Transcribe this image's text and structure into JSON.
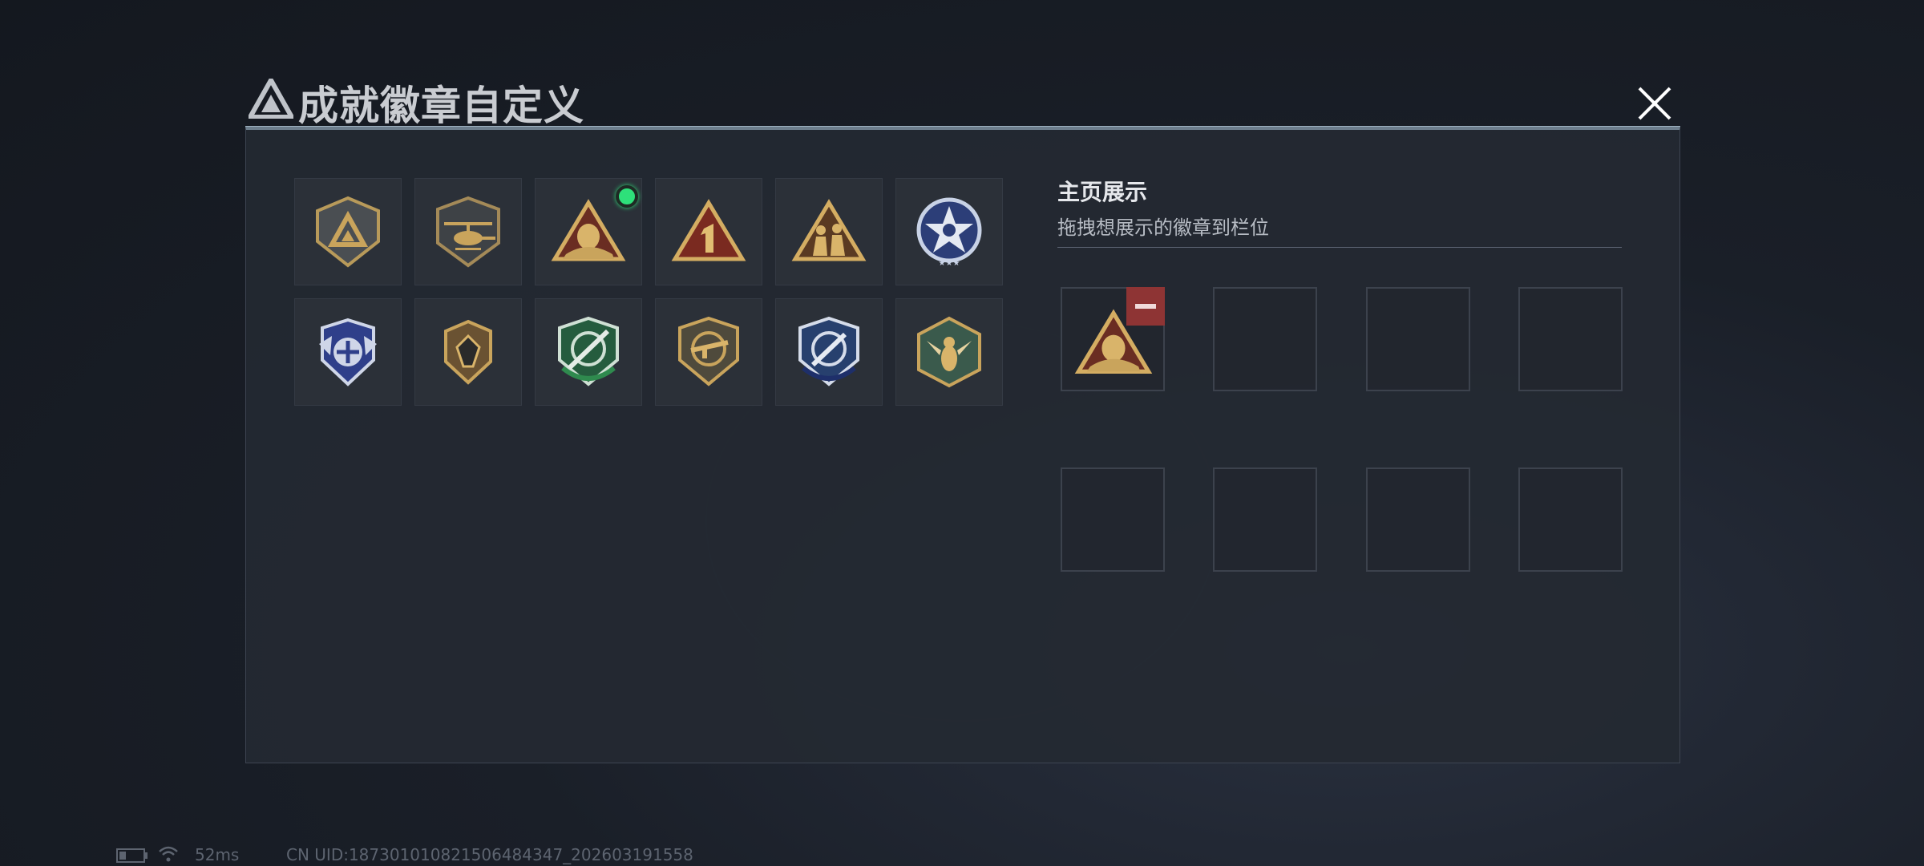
{
  "window": {
    "title": "成就徽章自定义"
  },
  "badges": [
    {
      "name": "triangle-shield-icon",
      "is_new": false
    },
    {
      "name": "helicopter-badge-icon",
      "is_new": false
    },
    {
      "name": "egg-triangle-badge-icon",
      "is_new": true
    },
    {
      "name": "number-one-badge-icon",
      "is_new": false
    },
    {
      "name": "soldiers-badge-icon",
      "is_new": false
    },
    {
      "name": "star-skull-badge-icon",
      "is_new": false
    },
    {
      "name": "blue-wing-shield-icon",
      "is_new": false
    },
    {
      "name": "gem-shield-badge-icon",
      "is_new": false
    },
    {
      "name": "green-rifle-crosshair-icon",
      "is_new": false
    },
    {
      "name": "gold-rifle-shield-icon",
      "is_new": false
    },
    {
      "name": "blue-knife-crosshair-icon",
      "is_new": false
    },
    {
      "name": "hornet-hexagon-icon",
      "is_new": false
    }
  ],
  "display": {
    "heading": "主页展示",
    "subtitle": "拖拽想展示的徽章到栏位",
    "slots": [
      {
        "filled": true,
        "badge": "egg-triangle-badge-icon"
      },
      {
        "filled": false
      },
      {
        "filled": false
      },
      {
        "filled": false
      },
      {
        "filled": false
      },
      {
        "filled": false
      },
      {
        "filled": false
      },
      {
        "filled": false
      }
    ]
  },
  "status": {
    "ping": "52ms",
    "uid": "CN UID:187301010821506484347_202603191558"
  },
  "colors": {
    "accent_new": "#2ee07a",
    "remove": "#8e3434",
    "badge_gold": "#c9a45c"
  }
}
